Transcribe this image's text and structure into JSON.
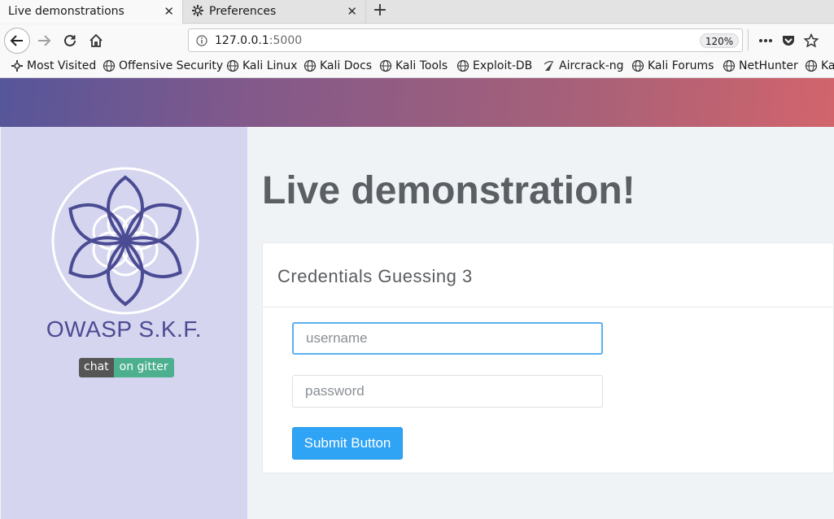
{
  "browser": {
    "tabs": [
      {
        "label": "Live demonstrations",
        "active": true
      },
      {
        "label": "Preferences",
        "active": false
      }
    ],
    "url_host": "127.0.0.1",
    "url_port": ":5000",
    "zoom": "120%",
    "bookmarks": [
      "Most Visited",
      "Offensive Security",
      "Kali Linux",
      "Kali Docs",
      "Kali Tools",
      "Exploit-DB",
      "Aircrack-ng",
      "Kali Forums",
      "NetHunter",
      "Ka"
    ]
  },
  "sidebar": {
    "brand": "OWASP S.K.F.",
    "gitter_left": "chat",
    "gitter_right": "on gitter"
  },
  "main": {
    "heading": "Live demonstration!",
    "card_title": "Credentials Guessing 3",
    "username_placeholder": "username",
    "password_placeholder": "password",
    "submit_label": "Submit Button"
  },
  "colors": {
    "accent": "#2fa4f5",
    "brand": "#4b4b93",
    "sidebar_bg": "#d5d5ef",
    "gitter_green": "#4cb08f"
  }
}
